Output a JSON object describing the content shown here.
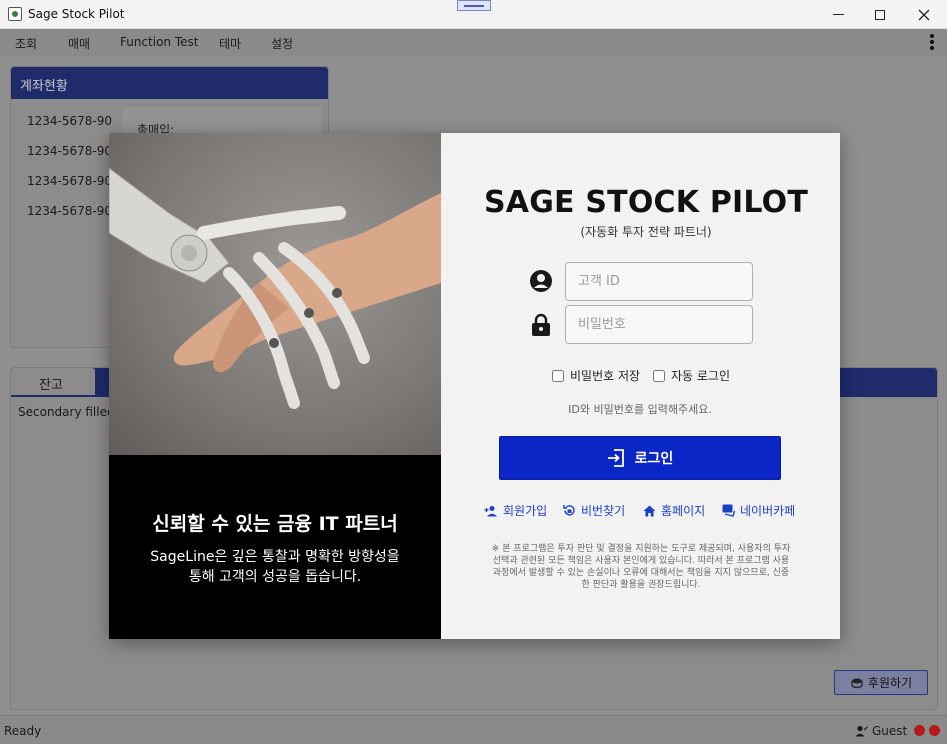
{
  "window": {
    "title": "Sage Stock Pilot"
  },
  "menu": {
    "items": [
      "조회",
      "매매",
      "Function Test",
      "테마",
      "설정"
    ]
  },
  "account_panel": {
    "header": "계좌현황",
    "accounts": [
      "1234-5678-90",
      "1234-5678-90",
      "1234-5678-90",
      "1234-5678-90"
    ],
    "summary_label": "총매입:"
  },
  "balance_panel": {
    "tab": "잔고",
    "subtitle": "Secondary filled"
  },
  "donate": {
    "label": "후원하기"
  },
  "status": {
    "ready": "Ready",
    "user": "Guest"
  },
  "modal": {
    "hero_title": "신뢰할 수 있는 금융 IT 파트너",
    "hero_desc_line1": "SageLine은 깊은 통찰과 명확한 방향성을",
    "hero_desc_line2": "통해 고객의 성공을 돕습니다.",
    "brand": "SAGE STOCK PILOT",
    "brand_sub": "(자동화 투자 전략 파트너)",
    "id_placeholder": "고객 ID",
    "pw_placeholder": "비밀번호",
    "save_pw": "비밀번호 저장",
    "auto_login": "자동 로그인",
    "hint": "ID와 비밀번호를 입력해주세요.",
    "login": "로그인",
    "links": {
      "signup": "회원가입",
      "find_pw": "비번찾기",
      "homepage": "홈페이지",
      "cafe": "네이버카페"
    },
    "notice_line1": "※ 본 프로그램은 투자 판단 및 결정을 지원하는 도구로 제공되며, 사용자의 투자",
    "notice_line2": "선택과 관련된 모든 책임은 사용자 본인에게 있습니다. 따라서 본 프로그램 사용",
    "notice_line3": "과정에서 발생할 수 있는 손실이나 오류에 대해서는 책임을 지지 않으므로, 신중",
    "notice_line4": "한 판단과 활용을 권장드립니다."
  },
  "colors": {
    "accent": "#0a26c6",
    "header": "#1f2b6b",
    "link": "#1a3fc9",
    "status_dot": "#b31a1a"
  }
}
